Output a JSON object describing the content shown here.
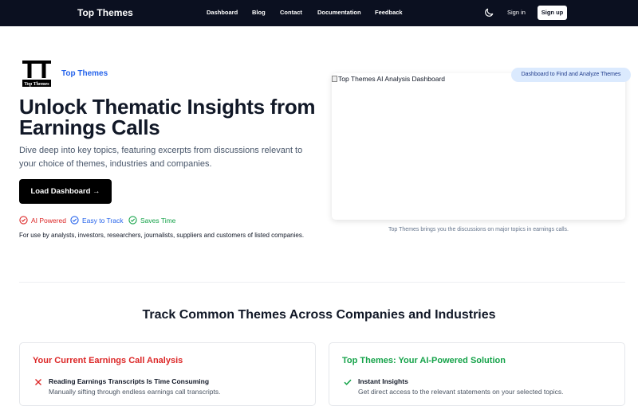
{
  "navbar": {
    "brand": "Top Themes",
    "links": [
      "Dashboard",
      "Blog",
      "Contact",
      "Documentation",
      "Feedback"
    ],
    "theme_toggle_icon": "moon-icon",
    "sign_in": "Sign in",
    "sign_up": "Sign up"
  },
  "hero": {
    "logo_text": "Top Themes",
    "logo_mark": "TT",
    "brand_name": "Top Themes",
    "title": "Unlock Thematic Insights from Earnings Calls",
    "subtitle": "Dive deep into key topics, featuring excerpts from discussions relevant to your choice of themes, industries and companies.",
    "cta_label": "Load Dashboard →",
    "features": [
      {
        "label": "AI Powered",
        "icon": "check-circle-icon",
        "color": "#dc2626"
      },
      {
        "label": "Easy to Track",
        "icon": "check-circle-icon",
        "color": "#2563eb"
      },
      {
        "label": "Saves Time",
        "icon": "check-circle-icon",
        "color": "#16a34a"
      }
    ],
    "audience": "For use by analysts, investors, researchers, journalists, suppliers and customers of listed companies."
  },
  "preview": {
    "image_alt": "Top Themes AI Analysis Dashboard",
    "badge": "Dashboard to Find and Analyze Themes",
    "caption": "Top Themes brings you the discussions on major topics in earnings calls."
  },
  "section": {
    "title": "Track Common Themes Across Companies and Industries"
  },
  "comparison": {
    "left": {
      "title": "Your Current Earnings Call Analysis",
      "color": "#dc2626",
      "items": [
        {
          "title": "Reading Earnings Transcripts Is Time Consuming",
          "desc": "Manually sifting through endless earnings call transcripts.",
          "icon": "x-icon"
        }
      ]
    },
    "right": {
      "title": "Top Themes: Your AI-Powered Solution",
      "color": "#16a34a",
      "items": [
        {
          "title": "Instant Insights",
          "desc": "Get direct access to the relevant statements on your selected topics.",
          "icon": "check-icon"
        }
      ]
    }
  }
}
